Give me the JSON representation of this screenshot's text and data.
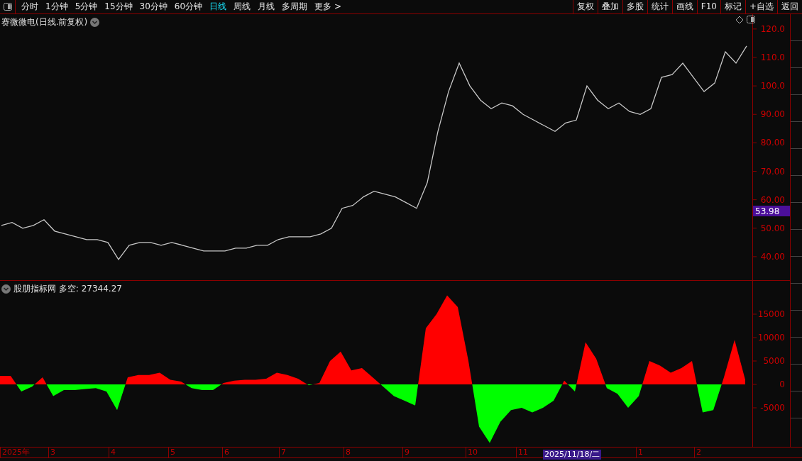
{
  "toolbar": {
    "periods": [
      {
        "label": "分时",
        "selected": false
      },
      {
        "label": "1分钟",
        "selected": false
      },
      {
        "label": "5分钟",
        "selected": false
      },
      {
        "label": "15分钟",
        "selected": false
      },
      {
        "label": "30分钟",
        "selected": false
      },
      {
        "label": "60分钟",
        "selected": false
      },
      {
        "label": "日线",
        "selected": true
      },
      {
        "label": "周线",
        "selected": false
      },
      {
        "label": "月线",
        "selected": false
      },
      {
        "label": "多周期",
        "selected": false
      },
      {
        "label": "更多 >",
        "selected": false
      }
    ],
    "actions": [
      "复权",
      "叠加",
      "多股",
      "统计",
      "画线",
      "F10",
      "标记",
      "+自选",
      "返回"
    ]
  },
  "price_pane": {
    "title": "赛微微电(日线.前复权)",
    "last_price_tag": "53.98",
    "chart_data": {
      "type": "line",
      "ylim": [
        31.5,
        125.2
      ],
      "yticks": [
        {
          "value": 120,
          "label": "120.0"
        },
        {
          "value": 110,
          "label": "110.0"
        },
        {
          "value": 100,
          "label": "100.0"
        },
        {
          "value": 90,
          "label": "90.00"
        },
        {
          "value": 80,
          "label": "80.00"
        },
        {
          "value": 70,
          "label": "70.00"
        },
        {
          "value": 60,
          "label": "60.00"
        },
        {
          "value": 50,
          "label": "50.00"
        },
        {
          "value": 40,
          "label": "40.00"
        }
      ],
      "series": [
        {
          "color": "#c8c8c8",
          "values": [
            51,
            52,
            50,
            51,
            53,
            49,
            48,
            47,
            46,
            46,
            45,
            39,
            44,
            45,
            45,
            44,
            45,
            44,
            43,
            42,
            42,
            42,
            43,
            43,
            44,
            44,
            46,
            47,
            47,
            47,
            48,
            50,
            57,
            58,
            61,
            63,
            62,
            61,
            59,
            57,
            66,
            84,
            98,
            108,
            100,
            95,
            92,
            94,
            93,
            90,
            88,
            86,
            84,
            87,
            88,
            100,
            95,
            92,
            94,
            91,
            90,
            92,
            103,
            104,
            108,
            103,
            98,
            101,
            112,
            108,
            114
          ]
        }
      ]
    }
  },
  "indicator_pane": {
    "title": "股朋指标网 多空: 27344.27",
    "chart_data": {
      "type": "area",
      "ylim": [
        -13333,
        22121
      ],
      "yticks": [
        {
          "value": 15000,
          "label": "15000"
        },
        {
          "value": 10000,
          "label": "10000"
        },
        {
          "value": 5000,
          "label": "5000"
        },
        {
          "value": 0,
          "label": "0"
        },
        {
          "value": -5000,
          "label": "-5000"
        }
      ],
      "series": [
        {
          "color": "#ff0000",
          "values": [
            1800,
            1800,
            -1500,
            -500,
            1500,
            -2500,
            -1200,
            -1200,
            -1000,
            -800,
            -1500,
            -5500,
            1500,
            2000,
            2000,
            2500,
            1000,
            600,
            -800,
            -1200,
            -1200,
            300,
            800,
            1000,
            1000,
            1200,
            2500,
            2000,
            1200,
            -200,
            300,
            5000,
            7000,
            3000,
            3500,
            1500,
            -500,
            -2500,
            -3500,
            -4500,
            12000,
            15000,
            19000,
            16500,
            5000,
            -9000,
            -12500,
            -8000,
            -5500,
            -5000,
            -6000,
            -5000,
            -3500,
            800,
            -1500,
            9000,
            5500,
            -800,
            -2000,
            -5000,
            -2500,
            5000,
            4000,
            2500,
            3500,
            5000,
            -6000,
            -5500,
            1500,
            9500,
            1000
          ]
        }
      ]
    }
  },
  "time_axis": [
    {
      "label": "2025年",
      "selected": false
    },
    {
      "label": "3",
      "selected": false
    },
    {
      "label": "4",
      "selected": false
    },
    {
      "label": "5",
      "selected": false
    },
    {
      "label": "6",
      "selected": false
    },
    {
      "label": "7",
      "selected": false
    },
    {
      "label": "8",
      "selected": false
    },
    {
      "label": "9",
      "selected": false
    },
    {
      "label": "10",
      "selected": false
    },
    {
      "label": "11",
      "selected": false
    },
    {
      "label": "2025/11/18/二",
      "selected": true
    },
    {
      "label": "1",
      "selected": false
    },
    {
      "label": "2",
      "selected": false
    }
  ]
}
